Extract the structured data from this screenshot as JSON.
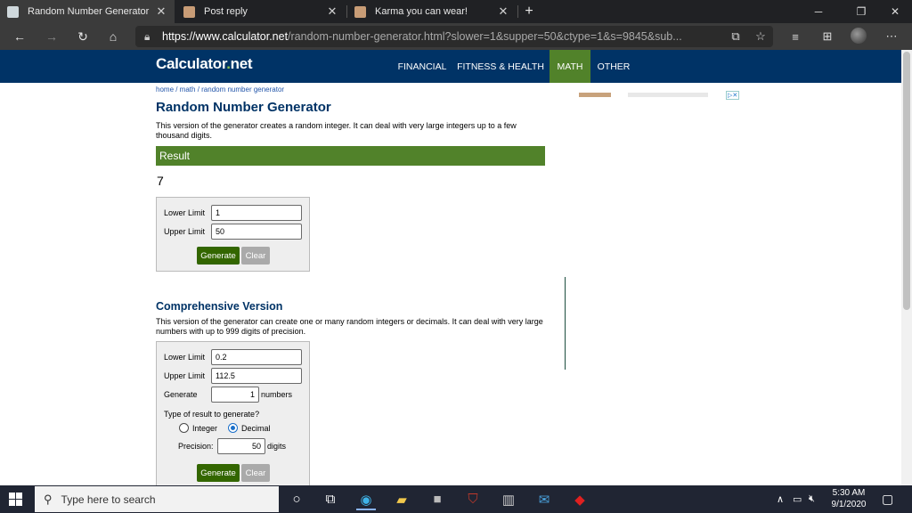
{
  "browser": {
    "tabs": [
      {
        "title": "Random Number Generator",
        "active": true
      },
      {
        "title": "Post reply",
        "active": false
      },
      {
        "title": "Karma you can wear!",
        "active": false
      }
    ],
    "new_tab": "+",
    "url_host": "https://www.calculator.net",
    "url_path": "/random-number-generator.html?slower=1&supper=50&ctype=1&s=9845&sub..."
  },
  "site": {
    "logo_main": "Calculator",
    "logo_dot": ".",
    "logo_tld": "net",
    "menu": [
      "FINANCIAL",
      "FITNESS & HEALTH",
      "MATH",
      "OTHER"
    ],
    "active_menu": "MATH",
    "accent_green": "#51822a",
    "header_navy": "#003366"
  },
  "page": {
    "breadcrumb": "home / math / random number generator",
    "title": "Random Number Generator",
    "description": "This version of the generator creates a random integer. It can deal with very large integers up to a few thousand digits.",
    "result_heading": "Result",
    "result_value": "7",
    "simple_form": {
      "lower_label": "Lower Limit",
      "lower_value": "1",
      "upper_label": "Upper Limit",
      "upper_value": "50",
      "generate": "Generate",
      "clear": "Clear"
    },
    "comprehensive": {
      "heading": "Comprehensive Version",
      "description": "This version of the generator can create one or many random integers or decimals. It can deal with very large numbers with up to 999 digits of precision.",
      "lower_label": "Lower Limit",
      "lower_value": "0.2",
      "upper_label": "Upper Limit",
      "upper_value": "112.5",
      "generate_label": "Generate",
      "count_value": "1",
      "count_unit": "numbers",
      "type_label": "Type of result to generate?",
      "type_integer": "Integer",
      "type_decimal": "Decimal",
      "selected_type": "Decimal",
      "precision_label": "Precision:",
      "precision_value": "50",
      "precision_unit": "digits",
      "generate": "Generate",
      "clear": "Clear"
    },
    "ad_choices": "▷✕"
  },
  "taskbar": {
    "search_placeholder": "Type here to search",
    "time": "5:30 AM",
    "date": "9/1/2020"
  }
}
